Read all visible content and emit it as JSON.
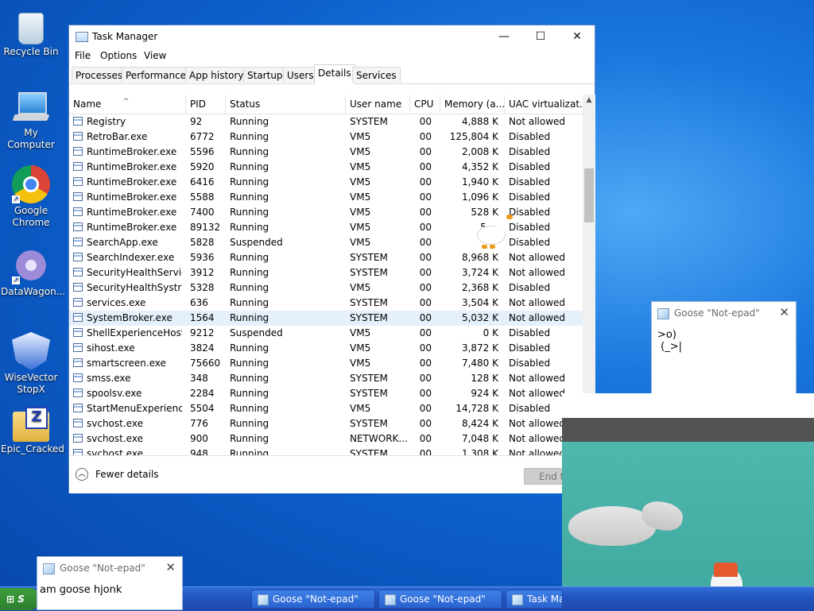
{
  "desktop": {
    "icons": [
      {
        "label": "Recycle Bin"
      },
      {
        "label": "My Computer"
      },
      {
        "label": "Google Chrome"
      },
      {
        "label": "DataWagon..."
      },
      {
        "label": "WiseVector StopX"
      },
      {
        "label": "Epic_Cracked"
      }
    ]
  },
  "taskmanager": {
    "title": "Task Manager",
    "menu": [
      "File",
      "Options",
      "View"
    ],
    "tabs": [
      "Processes",
      "Performance",
      "App history",
      "Startup",
      "Users",
      "Details",
      "Services"
    ],
    "active_tab": "Details",
    "columns": [
      "Name",
      "PID",
      "Status",
      "User name",
      "CPU",
      "Memory (a...",
      "UAC virtualizat..."
    ],
    "rows": [
      {
        "name": "Registry",
        "pid": "92",
        "status": "Running",
        "user": "SYSTEM",
        "cpu": "00",
        "mem": "4,888 K",
        "uac": "Not allowed"
      },
      {
        "name": "RetroBar.exe",
        "pid": "6772",
        "status": "Running",
        "user": "VM5",
        "cpu": "00",
        "mem": "125,804 K",
        "uac": "Disabled"
      },
      {
        "name": "RuntimeBroker.exe",
        "pid": "5596",
        "status": "Running",
        "user": "VM5",
        "cpu": "00",
        "mem": "2,008 K",
        "uac": "Disabled"
      },
      {
        "name": "RuntimeBroker.exe",
        "pid": "5920",
        "status": "Running",
        "user": "VM5",
        "cpu": "00",
        "mem": "4,352 K",
        "uac": "Disabled"
      },
      {
        "name": "RuntimeBroker.exe",
        "pid": "6416",
        "status": "Running",
        "user": "VM5",
        "cpu": "00",
        "mem": "1,940 K",
        "uac": "Disabled"
      },
      {
        "name": "RuntimeBroker.exe",
        "pid": "5588",
        "status": "Running",
        "user": "VM5",
        "cpu": "00",
        "mem": "1,096 K",
        "uac": "Disabled"
      },
      {
        "name": "RuntimeBroker.exe",
        "pid": "7400",
        "status": "Running",
        "user": "VM5",
        "cpu": "00",
        "mem": "528 K",
        "uac": "Disabled"
      },
      {
        "name": "RuntimeBroker.exe",
        "pid": "89132",
        "status": "Running",
        "user": "VM5",
        "cpu": "00",
        "mem": "5,...",
        "uac": "Disabled"
      },
      {
        "name": "SearchApp.exe",
        "pid": "5828",
        "status": "Suspended",
        "user": "VM5",
        "cpu": "00",
        "mem": "",
        "uac": "Disabled"
      },
      {
        "name": "SearchIndexer.exe",
        "pid": "5936",
        "status": "Running",
        "user": "SYSTEM",
        "cpu": "00",
        "mem": "8,968 K",
        "uac": "Not allowed"
      },
      {
        "name": "SecurityHealthServic...",
        "pid": "3912",
        "status": "Running",
        "user": "SYSTEM",
        "cpu": "00",
        "mem": "3,724 K",
        "uac": "Not allowed"
      },
      {
        "name": "SecurityHealthSystra...",
        "pid": "5328",
        "status": "Running",
        "user": "VM5",
        "cpu": "00",
        "mem": "2,368 K",
        "uac": "Disabled"
      },
      {
        "name": "services.exe",
        "pid": "636",
        "status": "Running",
        "user": "SYSTEM",
        "cpu": "00",
        "mem": "3,504 K",
        "uac": "Not allowed"
      },
      {
        "name": "SystemBroker.exe",
        "pid": "1564",
        "status": "Running",
        "user": "SYSTEM",
        "cpu": "00",
        "mem": "5,032 K",
        "uac": "Not allowed"
      },
      {
        "name": "ShellExperienceHost...",
        "pid": "9212",
        "status": "Suspended",
        "user": "VM5",
        "cpu": "00",
        "mem": "0 K",
        "uac": "Disabled"
      },
      {
        "name": "sihost.exe",
        "pid": "3824",
        "status": "Running",
        "user": "VM5",
        "cpu": "00",
        "mem": "3,872 K",
        "uac": "Disabled"
      },
      {
        "name": "smartscreen.exe",
        "pid": "75660",
        "status": "Running",
        "user": "VM5",
        "cpu": "00",
        "mem": "7,480 K",
        "uac": "Disabled"
      },
      {
        "name": "smss.exe",
        "pid": "348",
        "status": "Running",
        "user": "SYSTEM",
        "cpu": "00",
        "mem": "128 K",
        "uac": "Not allowed"
      },
      {
        "name": "spoolsv.exe",
        "pid": "2284",
        "status": "Running",
        "user": "SYSTEM",
        "cpu": "00",
        "mem": "924 K",
        "uac": "Not allowed"
      },
      {
        "name": "StartMenuExperienc...",
        "pid": "5504",
        "status": "Running",
        "user": "VM5",
        "cpu": "00",
        "mem": "14,728 K",
        "uac": "Disabled"
      },
      {
        "name": "svchost.exe",
        "pid": "776",
        "status": "Running",
        "user": "SYSTEM",
        "cpu": "00",
        "mem": "8,424 K",
        "uac": "Not allowed"
      },
      {
        "name": "svchost.exe",
        "pid": "900",
        "status": "Running",
        "user": "NETWORK...",
        "cpu": "00",
        "mem": "7,048 K",
        "uac": "Not allowed"
      },
      {
        "name": "svchost.exe",
        "pid": "948",
        "status": "Running",
        "user": "SYSTEM",
        "cpu": "00",
        "mem": "1,308 K",
        "uac": "Not allowed"
      }
    ],
    "selected_row": 13,
    "fewer_details": "Fewer details",
    "end_task": "End task"
  },
  "goose_note_right": {
    "title": "Goose \"Not-epad\"",
    "text": ">o)\n (_>|"
  },
  "goose_note_left": {
    "title": "Goose \"Not-epad\"",
    "text": "am goose hjonk"
  },
  "taskbar": {
    "start_label": "S",
    "buttons": [
      {
        "label": "Goose \"Not-epad\""
      },
      {
        "label": "Goose \"Not-epad\""
      },
      {
        "label": "Task Manager"
      }
    ]
  },
  "colors": {
    "accent": "#0078d7",
    "taskbar": "#245edb",
    "selected_row": "#e5f0fb"
  }
}
